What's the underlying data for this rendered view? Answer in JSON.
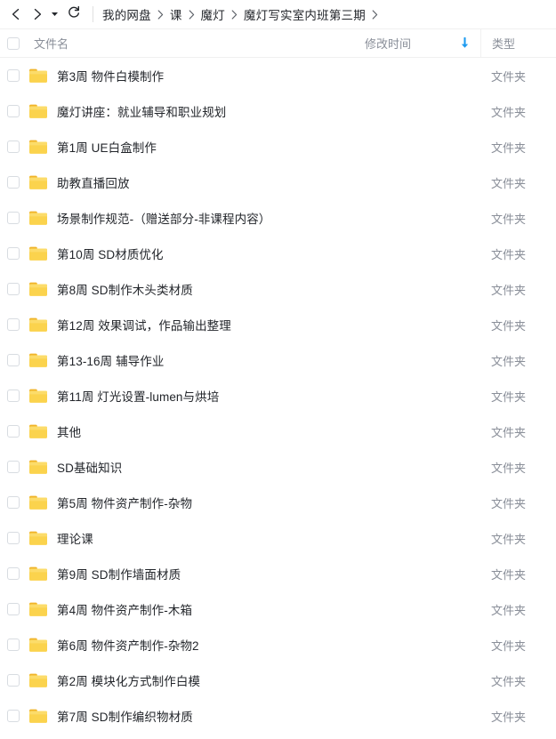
{
  "toolbar": {
    "back_icon": "chevron-left-icon",
    "forward_icon": "chevron-right-icon",
    "history_caret_icon": "caret-down-icon",
    "refresh_icon": "refresh-icon"
  },
  "breadcrumb": {
    "separator": "›",
    "items": [
      {
        "label": "我的网盘"
      },
      {
        "label": "课"
      },
      {
        "label": "魔灯"
      },
      {
        "label": "魔灯写实室内班第三期"
      }
    ]
  },
  "columns": {
    "name": "文件名",
    "modified_time": "修改时间",
    "type": "类型",
    "sort_icon": "sort-descending-arrow-icon",
    "sort_color": "#1e9bf0"
  },
  "colors": {
    "folder_fill": "#f7c948",
    "folder_fill_light": "#ffd760",
    "text_primary": "#23262b",
    "text_secondary": "#8a8f99",
    "accent": "#1e9bf0",
    "border": "#f0f0f0"
  },
  "files": [
    {
      "name": "第3周 物件白模制作",
      "modified": "",
      "type": "文件夹"
    },
    {
      "name": "魔灯讲座：就业辅导和职业规划",
      "modified": "",
      "type": "文件夹"
    },
    {
      "name": "第1周 UE白盒制作",
      "modified": "",
      "type": "文件夹"
    },
    {
      "name": "助教直播回放",
      "modified": "",
      "type": "文件夹"
    },
    {
      "name": "场景制作规范-（赠送部分-非课程内容）",
      "modified": "",
      "type": "文件夹"
    },
    {
      "name": "第10周 SD材质优化",
      "modified": "",
      "type": "文件夹"
    },
    {
      "name": "第8周 SD制作木头类材质",
      "modified": "",
      "type": "文件夹"
    },
    {
      "name": "第12周 效果调试，作品输出整理",
      "modified": "",
      "type": "文件夹"
    },
    {
      "name": "第13-16周 辅导作业",
      "modified": "",
      "type": "文件夹"
    },
    {
      "name": "第11周 灯光设置-lumen与烘培",
      "modified": "",
      "type": "文件夹"
    },
    {
      "name": "其他",
      "modified": "",
      "type": "文件夹"
    },
    {
      "name": "SD基础知识",
      "modified": "",
      "type": "文件夹"
    },
    {
      "name": "第5周 物件资产制作-杂物",
      "modified": "",
      "type": "文件夹"
    },
    {
      "name": "理论课",
      "modified": "",
      "type": "文件夹"
    },
    {
      "name": "第9周 SD制作墙面材质",
      "modified": "",
      "type": "文件夹"
    },
    {
      "name": "第4周 物件资产制作-木箱",
      "modified": "",
      "type": "文件夹"
    },
    {
      "name": "第6周 物件资产制作-杂物2",
      "modified": "",
      "type": "文件夹"
    },
    {
      "name": "第2周 模块化方式制作白模",
      "modified": "",
      "type": "文件夹"
    },
    {
      "name": "第7周 SD制作编织物材质",
      "modified": "",
      "type": "文件夹"
    }
  ]
}
